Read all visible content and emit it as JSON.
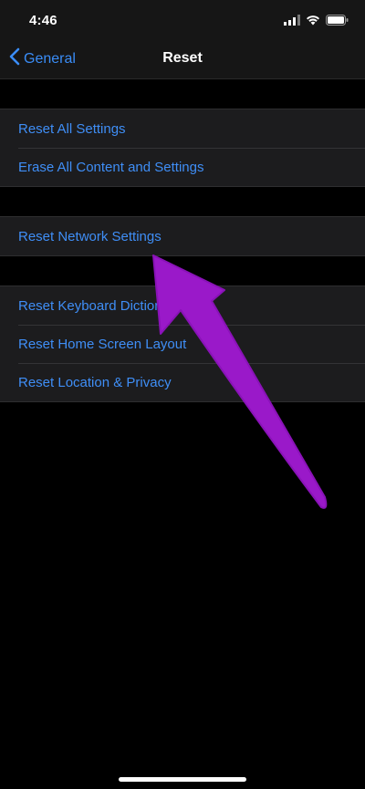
{
  "status_bar": {
    "time": "4:46",
    "icons": [
      "cellular-signal-icon",
      "wifi-icon",
      "battery-icon"
    ]
  },
  "nav": {
    "back_label": "General",
    "back_icon": "chevron-left-icon",
    "title": "Reset"
  },
  "groups": [
    {
      "items": [
        {
          "label": "Reset All Settings"
        },
        {
          "label": "Erase All Content and Settings"
        }
      ]
    },
    {
      "items": [
        {
          "label": "Reset Network Settings"
        }
      ]
    },
    {
      "items": [
        {
          "label": "Reset Keyboard Dictionary"
        },
        {
          "label": "Reset Home Screen Layout"
        },
        {
          "label": "Reset Location & Privacy"
        }
      ]
    }
  ],
  "annotation": {
    "icon": "arrow-pointer-icon",
    "color": "#9a19c9"
  },
  "colors": {
    "accent": "#3f8ef6",
    "background": "#000000",
    "group_bg": "#1c1c1e"
  }
}
